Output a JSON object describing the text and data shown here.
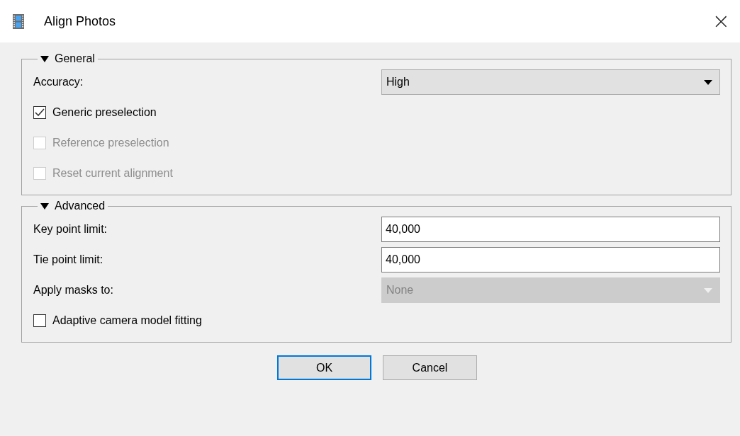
{
  "window": {
    "title": "Align Photos",
    "close": "×"
  },
  "groups": [
    {
      "title": "General",
      "expanded": true,
      "rows": [
        {
          "kind": "combo",
          "label": "Accuracy:",
          "value": "High",
          "disabled": false
        },
        {
          "kind": "checkbox",
          "label": "Generic preselection",
          "checked": true,
          "disabled": false
        },
        {
          "kind": "checkbox",
          "label": "Reference preselection",
          "checked": false,
          "disabled": true
        },
        {
          "kind": "checkbox",
          "label": "Reset current alignment",
          "checked": false,
          "disabled": true
        }
      ]
    },
    {
      "title": "Advanced",
      "expanded": true,
      "rows": [
        {
          "kind": "text",
          "label": "Key point limit:",
          "value": "40,000"
        },
        {
          "kind": "text",
          "label": "Tie point limit:",
          "value": "40,000"
        },
        {
          "kind": "combo",
          "label": "Apply masks to:",
          "value": "None",
          "disabled": true
        },
        {
          "kind": "checkbox",
          "label": "Adaptive camera model fitting",
          "checked": false,
          "disabled": false
        }
      ]
    }
  ],
  "buttons": [
    {
      "label": "OK",
      "default": true
    },
    {
      "label": "Cancel",
      "default": false
    }
  ]
}
